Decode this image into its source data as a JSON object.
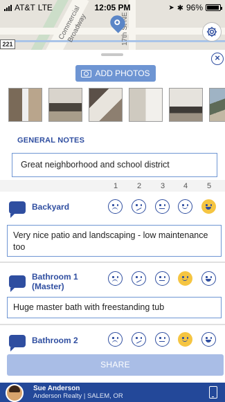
{
  "status_bar": {
    "carrier": "AT&T",
    "network": "LTE",
    "time": "12:05 PM",
    "battery": "96%"
  },
  "map": {
    "streets": [
      "Commercial",
      "Broadway",
      "17th St NE"
    ],
    "route_badge": "221"
  },
  "sheet": {
    "add_photos_label": "ADD PHOTOS",
    "photo_count": 7,
    "general_notes": {
      "title": "GENERAL NOTES",
      "value": "Great neighborhood and school district"
    },
    "rating_scale": [
      "1",
      "2",
      "3",
      "4",
      "5"
    ],
    "categories": [
      {
        "label": "Backyard",
        "rating": 5,
        "note": "Very nice patio and landscaping - low maintenance too"
      },
      {
        "label": "Bathroom 1 (Master)",
        "rating": 4,
        "note": "Huge master bath with freestanding tub"
      },
      {
        "label": "Bathroom 2",
        "rating": 4,
        "note": ""
      }
    ],
    "share_label": "SHARE"
  },
  "footer": {
    "agent_name": "Sue Anderson",
    "agent_company": "Anderson Realty | SALEM, OR"
  },
  "colors": {
    "brand": "#2f4ea0",
    "button": "#6e95d3",
    "share_disabled": "#a9bde6",
    "selected_face": "#f5c542",
    "footer": "#234899"
  }
}
